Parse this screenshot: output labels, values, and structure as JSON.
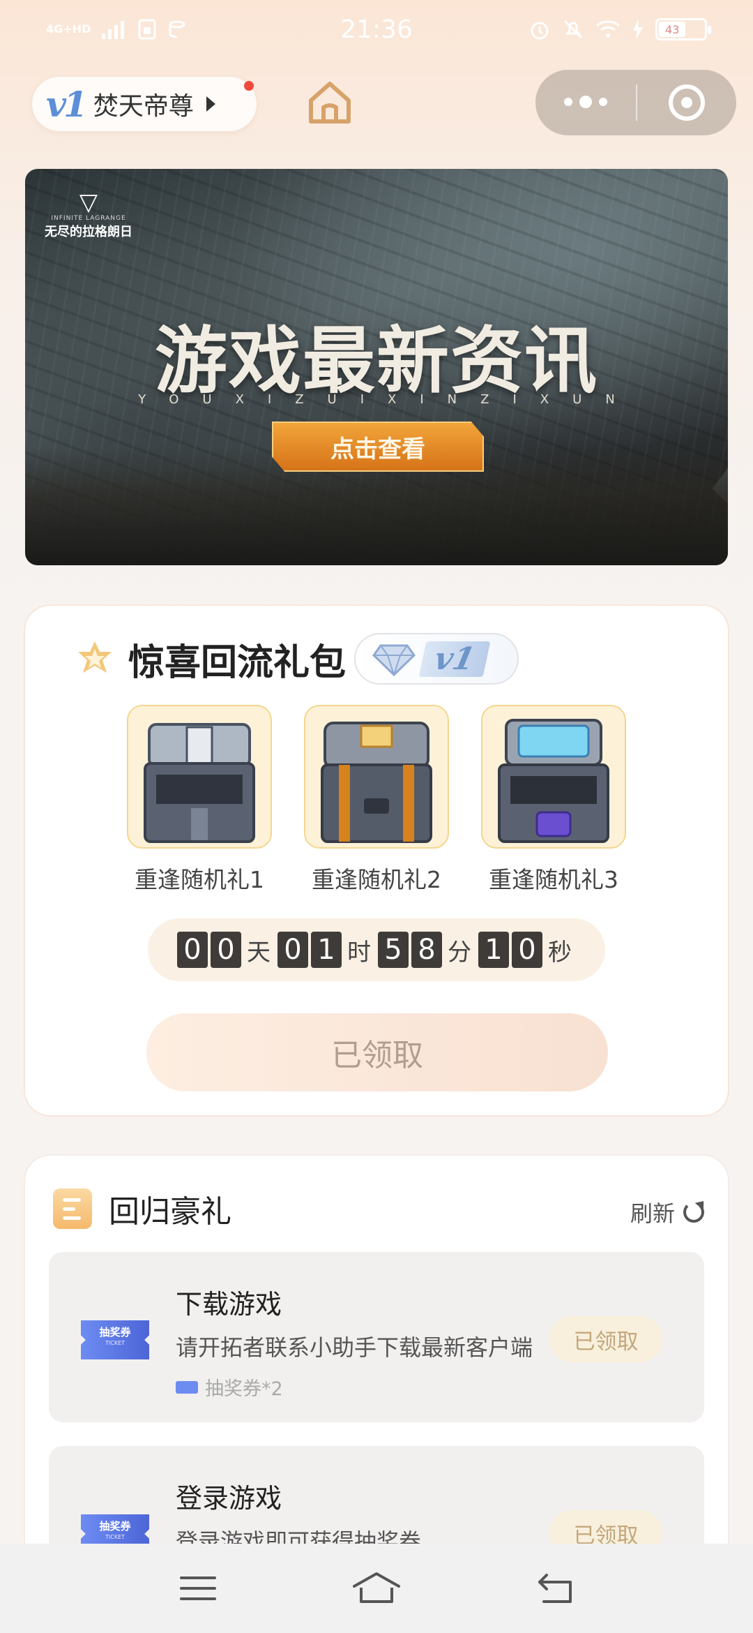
{
  "status_bar": {
    "network": "4G+HD",
    "time": "21:36",
    "battery": "43"
  },
  "header": {
    "vip_level": "v1",
    "user_name": "焚天帝尊"
  },
  "banner": {
    "brand_sub": "INFINITE LAGRANGE",
    "brand_name": "无尽的拉格朗日",
    "title": "游戏最新资讯",
    "pinyin": "YOUXIZUIXINZIXUN",
    "cta_label": "点击查看"
  },
  "gift_pack": {
    "title": "惊喜回流礼包",
    "vip_badge": "v1",
    "gifts": [
      {
        "label": "重逢随机礼1"
      },
      {
        "label": "重逢随机礼2"
      },
      {
        "label": "重逢随机礼3"
      }
    ],
    "countdown": {
      "days": [
        "0",
        "0"
      ],
      "hours": [
        "0",
        "1"
      ],
      "minutes": [
        "5",
        "8"
      ],
      "seconds": [
        "1",
        "0"
      ],
      "day_unit": "天",
      "hour_unit": "时",
      "minute_unit": "分",
      "second_unit": "秒"
    },
    "claim_button": "已领取"
  },
  "return_rewards": {
    "title": "回归豪礼",
    "refresh_label": "刷新",
    "tasks": [
      {
        "ticket_label": "抽奖券",
        "ticket_sub": "TICKET",
        "title": "下载游戏",
        "description": "请开拓者联系小助手下载最新客户端",
        "reward": "抽奖券*2",
        "status": "已领取"
      },
      {
        "ticket_label": "抽奖券",
        "ticket_sub": "TICKET",
        "title": "登录游戏",
        "description": "登录游戏即可获得抽奖券",
        "reward": "",
        "status": "已领取"
      }
    ]
  },
  "icons": {
    "home": "home-icon",
    "more": "more-dots-icon",
    "close": "target-close-icon",
    "gift_star": "star-icon",
    "vip_diamond": "diamond-icon",
    "reward_doc": "document-icon",
    "refresh": "refresh-icon",
    "nav_menu": "menu-icon",
    "nav_home": "home-icon",
    "nav_back": "back-icon"
  },
  "colors": {
    "accent_orange": "#d67318",
    "vip_blue": "#5d8fd8",
    "claimed_text": "#b29d91",
    "ticket_blue": "#4d65d7"
  }
}
